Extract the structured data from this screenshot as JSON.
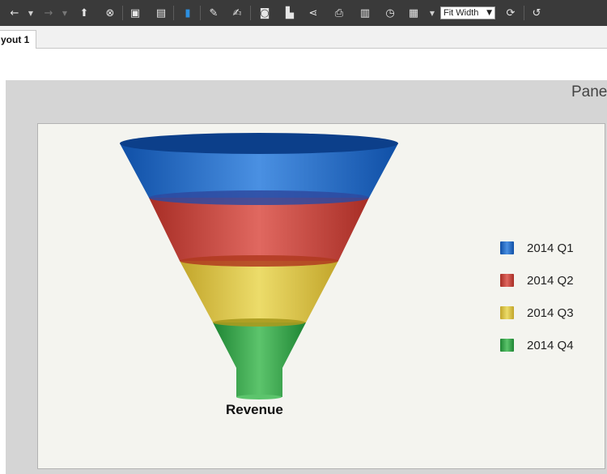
{
  "toolbar": {
    "zoom_value": "Fit Width",
    "icons": [
      "back-arrow-icon",
      "forward-arrow-icon",
      "upload-icon",
      "cancel-icon",
      "save-icon",
      "save-as-icon",
      "document-icon",
      "edit-pen-icon",
      "edit-note-icon",
      "camera-icon",
      "bookmark-icon",
      "share-icon",
      "print-icon",
      "print-preview-icon",
      "schedule-icon",
      "export-icon",
      "refresh-icon",
      "rotate-icon"
    ]
  },
  "tabs": [
    {
      "label": "yout 1"
    }
  ],
  "panel": {
    "title": "Pane"
  },
  "chart_data": {
    "type": "funnel",
    "label": "Revenue",
    "series": [
      {
        "name": "2014 Q1",
        "color": "#1e64c8"
      },
      {
        "name": "2014 Q2",
        "color": "#c73b32"
      },
      {
        "name": "2014 Q3",
        "color": "#d8be3e"
      },
      {
        "name": "2014 Q4",
        "color": "#2f9e44"
      }
    ]
  },
  "legend": [
    {
      "label": "2014 Q1",
      "color": "#1e64c8"
    },
    {
      "label": "2014 Q2",
      "color": "#c73b32"
    },
    {
      "label": "2014 Q3",
      "color": "#d8be3e"
    },
    {
      "label": "2014 Q4",
      "color": "#2f9e44"
    }
  ]
}
